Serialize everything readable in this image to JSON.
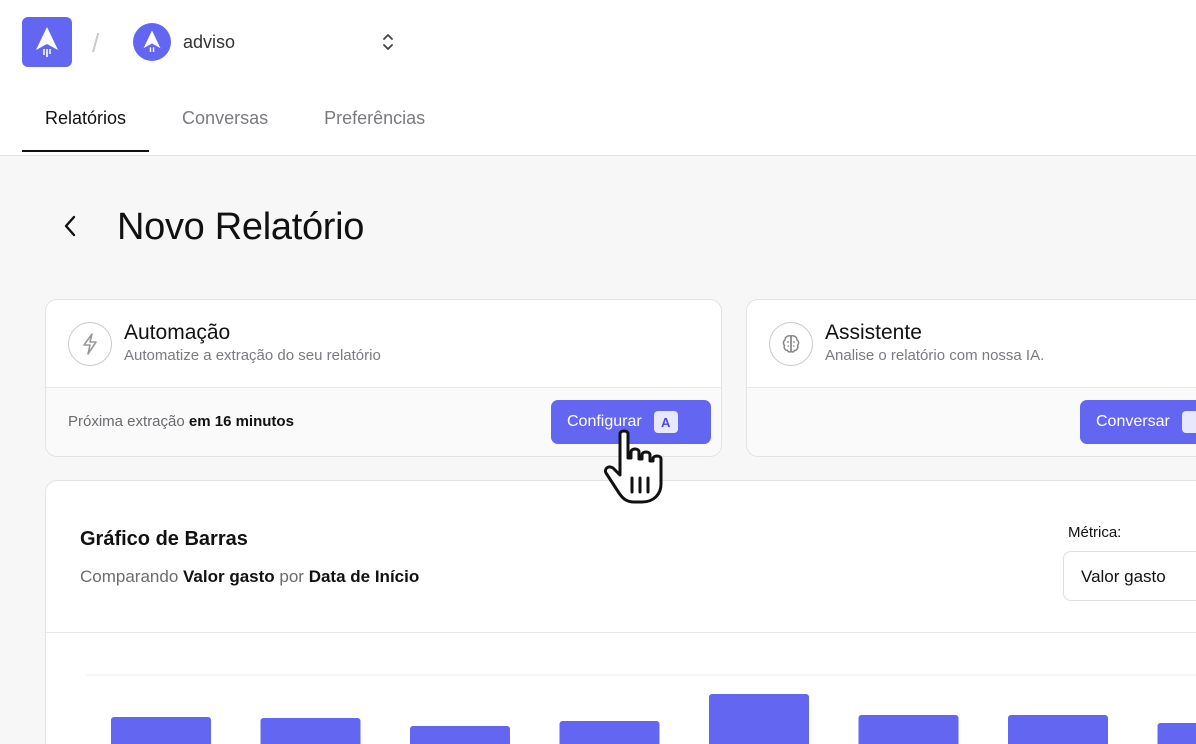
{
  "header": {
    "workspace": {
      "name": "adviso"
    },
    "tabs": [
      {
        "label": "Relatórios",
        "active": true
      },
      {
        "label": "Conversas",
        "active": false
      },
      {
        "label": "Preferências",
        "active": false
      }
    ]
  },
  "page": {
    "title": "Novo Relatório"
  },
  "automation": {
    "title": "Automação",
    "subtitle": "Automatize a extração do seu relatório",
    "next_prefix": "Próxima extração",
    "next_value": "em 16 minutos",
    "button_label": "Configurar",
    "shortcut": "A"
  },
  "assistant": {
    "title": "Assistente",
    "subtitle": "Analise o relatório com nossa IA.",
    "button_label": "Conversar"
  },
  "chart": {
    "title": "Gráfico de Barras",
    "desc_prefix": "Comparando",
    "desc_metric": "Valor gasto",
    "desc_mid": "por",
    "desc_dimension": "Data de Início",
    "metric_label": "Métrica:",
    "metric_value": "Valor gasto"
  },
  "colors": {
    "accent": "#6366f1",
    "accent_soft": "#e8e8fd"
  },
  "icons": {
    "logo": "paper-plane-icon",
    "switch": "chevrons-up-down-icon",
    "back": "chevron-left-icon",
    "automation": "lightning-icon",
    "assistant": "brain-icon",
    "cursor": "hand-pointer-icon"
  },
  "chart_data": {
    "type": "bar",
    "values": [
      29,
      28,
      20,
      25,
      52,
      31,
      31,
      23
    ],
    "ylim": [
      0,
      72
    ],
    "grid": false,
    "legend": "none"
  }
}
